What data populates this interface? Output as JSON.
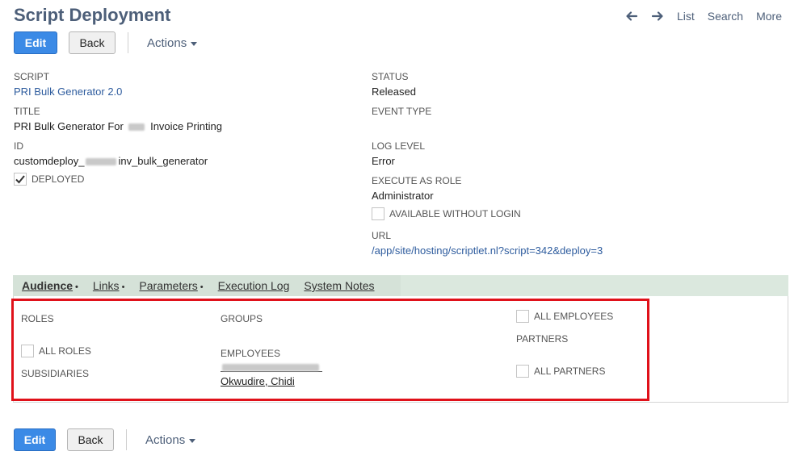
{
  "header": {
    "title": "Script Deployment",
    "nav": {
      "list": "List",
      "search": "Search",
      "more": "More"
    }
  },
  "toolbar": {
    "edit_label": "Edit",
    "back_label": "Back",
    "actions_label": "Actions"
  },
  "fields": {
    "script": {
      "label": "SCRIPT",
      "value": "PRI Bulk Generator 2.0"
    },
    "title": {
      "label": "TITLE",
      "value_prefix": "PRI Bulk Generator For",
      "value_suffix": "Invoice Printing"
    },
    "id": {
      "label": "ID",
      "value_prefix": "customdeploy_",
      "value_suffix": "inv_bulk_generator"
    },
    "deployed": {
      "label": "DEPLOYED",
      "checked": true
    },
    "status": {
      "label": "STATUS",
      "value": "Released"
    },
    "event_type": {
      "label": "EVENT TYPE",
      "value": ""
    },
    "log_level": {
      "label": "LOG LEVEL",
      "value": "Error"
    },
    "execute_as_role": {
      "label": "EXECUTE AS ROLE",
      "value": "Administrator"
    },
    "available_without_login": {
      "label": "AVAILABLE WITHOUT LOGIN",
      "checked": false
    },
    "url": {
      "label": "URL",
      "value": "/app/site/hosting/scriptlet.nl?script=342&deploy=3"
    }
  },
  "tabs": [
    {
      "label": "Audience",
      "dot": "•",
      "active": true
    },
    {
      "label": "Links",
      "dot": "•"
    },
    {
      "label": "Parameters",
      "dot": "•"
    },
    {
      "label": "Execution Log",
      "dot": ""
    },
    {
      "label": "System Notes",
      "dot": ""
    }
  ],
  "audience": {
    "roles_label": "ROLES",
    "all_roles_label": "ALL ROLES",
    "subsidiaries_label": "SUBSIDIARIES",
    "groups_label": "GROUPS",
    "employees_label": "EMPLOYEES",
    "employee_visible": "Okwudire, Chidi",
    "all_employees_label": "ALL EMPLOYEES",
    "partners_label": "PARTNERS",
    "all_partners_label": "ALL PARTNERS"
  },
  "colors": {
    "accent": "#3b8ae6",
    "link": "#2e5c9e",
    "tab_bar": "#d5e2d8",
    "highlight": "#e0111a",
    "title": "#4d5f79"
  },
  "icons": [
    "arrow-left-icon",
    "arrow-right-icon",
    "caret-down-icon",
    "checkmark-icon"
  ]
}
